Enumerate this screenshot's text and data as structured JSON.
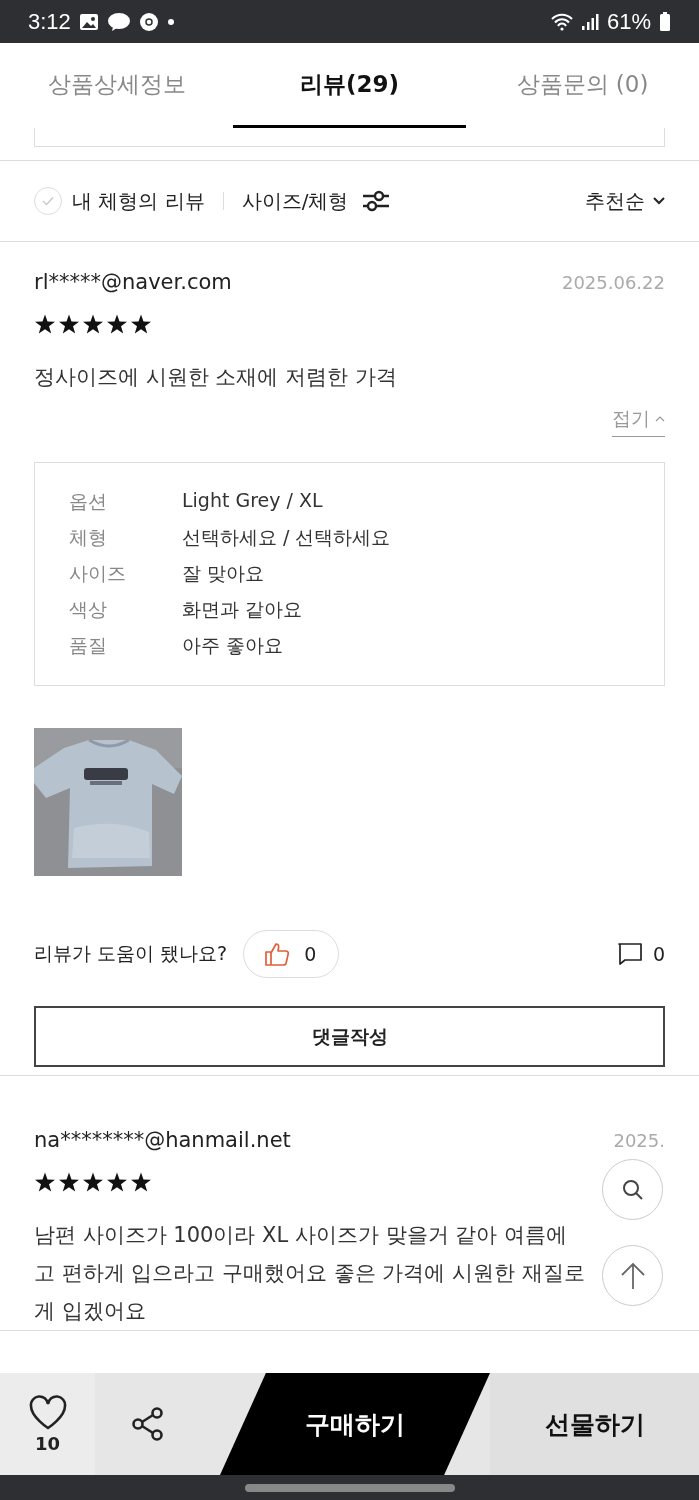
{
  "status_bar": {
    "time": "3:12",
    "battery": "61%"
  },
  "tabs": [
    {
      "label": "상품상세정보",
      "selected": false
    },
    {
      "label": "리뷰(29)",
      "selected": true
    },
    {
      "label": "상품문의 (0)",
      "selected": false
    }
  ],
  "filter": {
    "my_body_label": "내 체형의 리뷰",
    "my_body_checked": false,
    "size_filter": "사이즈/체형",
    "sort": "추천순"
  },
  "reviews": [
    {
      "user": "rl*****@naver.com",
      "date": "2025.06.22",
      "stars": 5,
      "lines": [
        "정사이즈에 시원한 소재에 저렴한 가격"
      ],
      "collapse": "접기",
      "details": [
        {
          "label": "옵션",
          "value": "Light Grey / XL"
        },
        {
          "label": "체형",
          "value": "선택하세요 / 선택하세요"
        },
        {
          "label": "사이즈",
          "value": "잘 맞아요"
        },
        {
          "label": "색상",
          "value": "화면과 같아요"
        },
        {
          "label": "품질",
          "value": "아주 좋아요"
        }
      ],
      "photos": [
        {
          "kind": "picture"
        }
      ],
      "helpful_question": "리뷰가 도움이 됐나요?",
      "likes": "0",
      "comments": "0",
      "comment_button": "댓글작성"
    },
    {
      "user": "na********@hanmail.net",
      "date": "2025.",
      "stars": 5,
      "lines": [
        "남편 사이즈가 100이라 XL 사이즈가 맞을거 같아 여름에",
        "고 편하게 입으라고 구매했어요 좋은 가격에 시원한 재질로",
        "게 입겠어요"
      ]
    }
  ],
  "bottom_bar": {
    "wish_count": "10",
    "buy": "구매하기",
    "gift": "선물하기"
  }
}
